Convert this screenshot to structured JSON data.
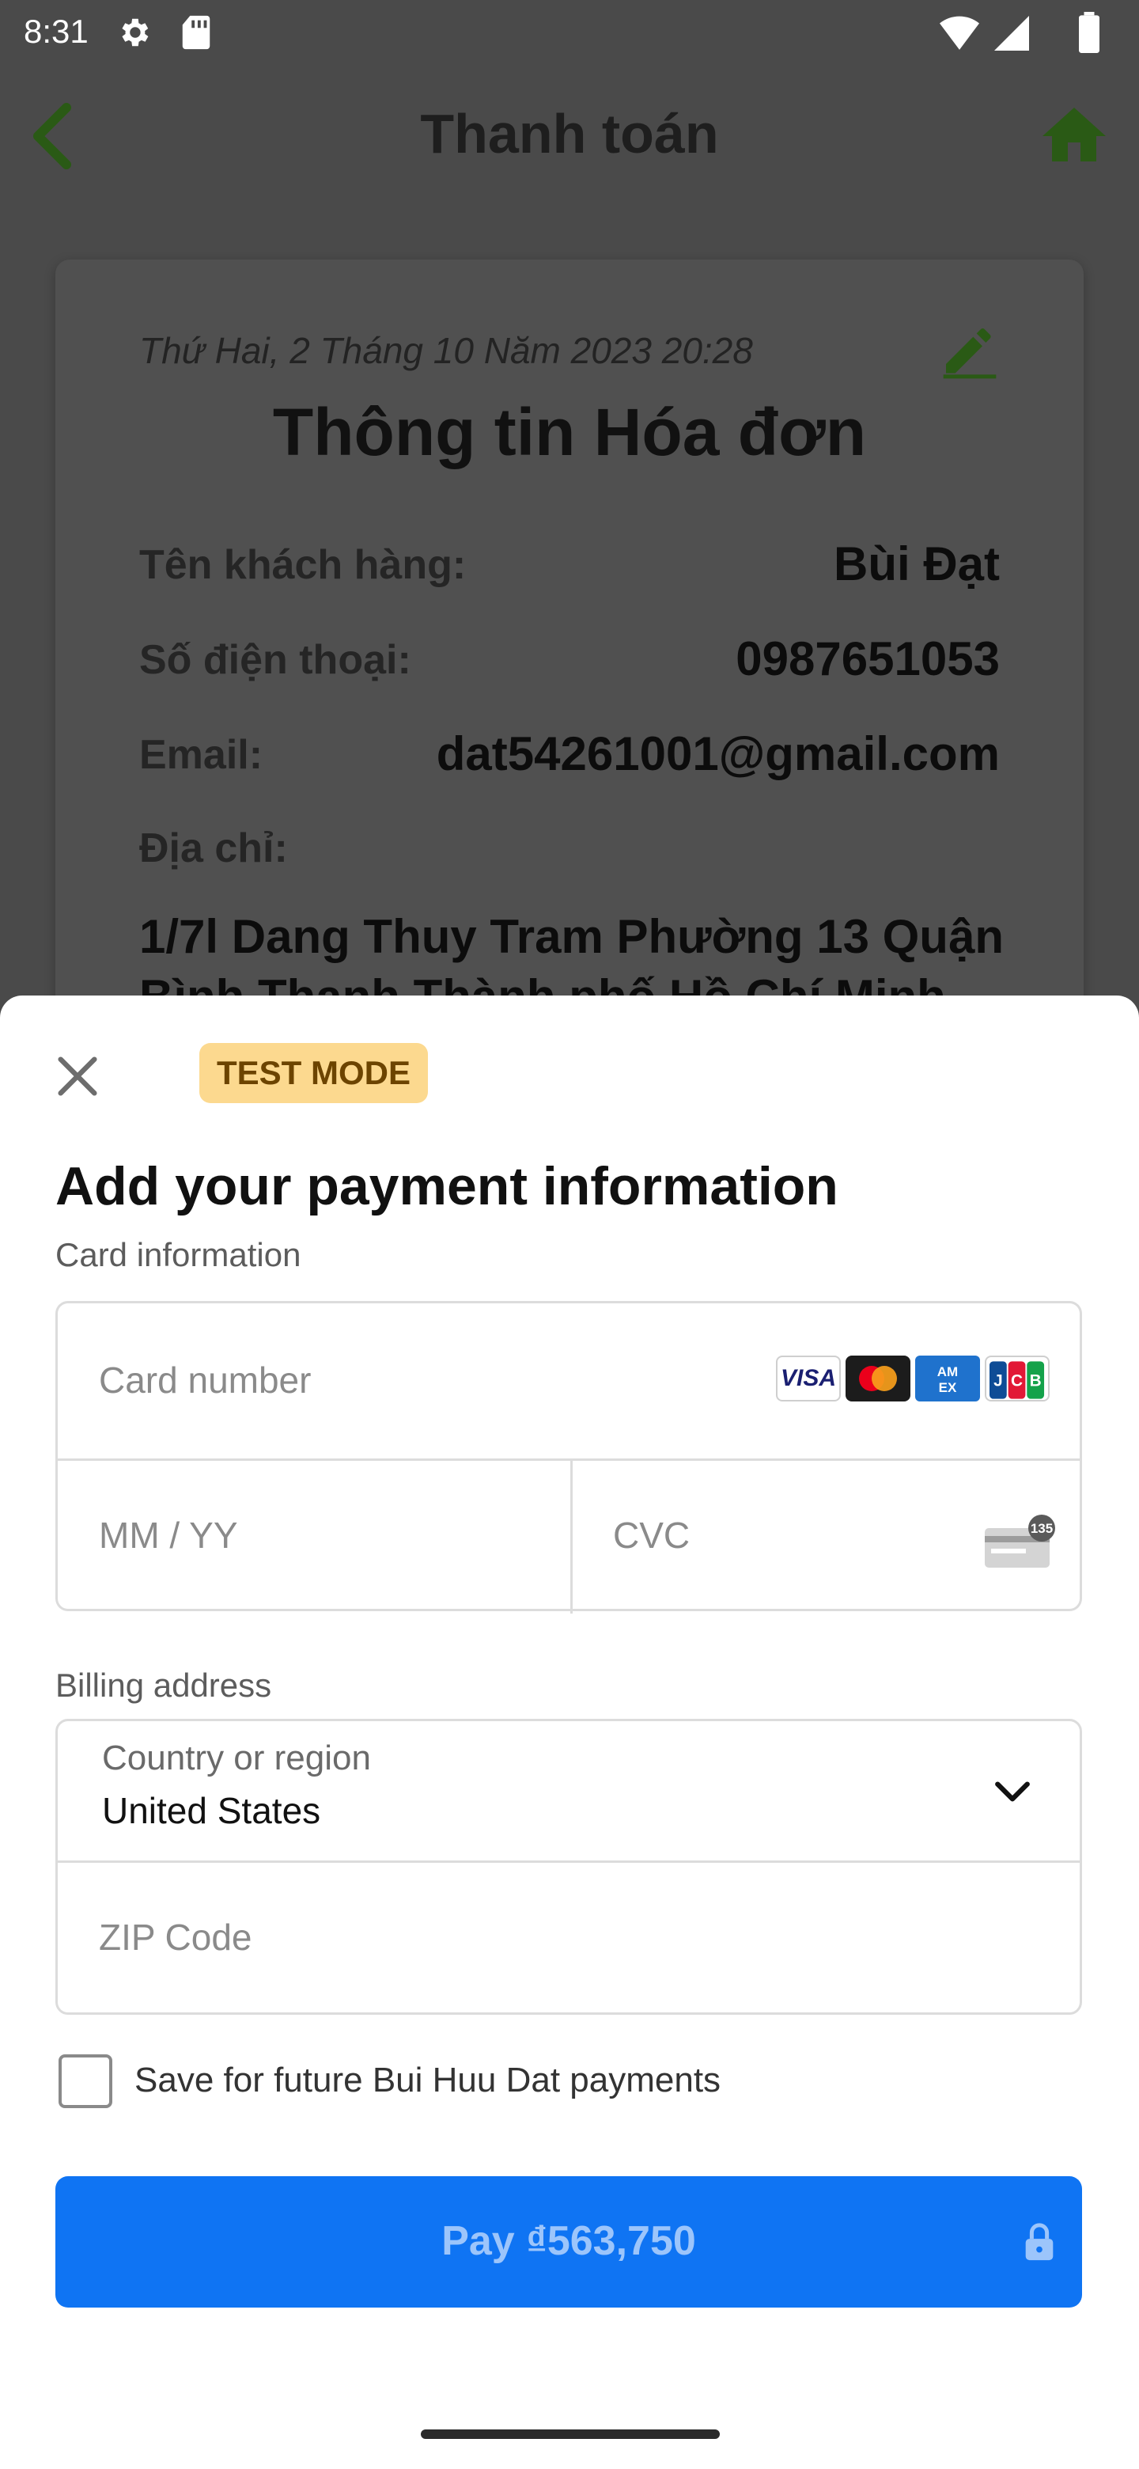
{
  "status_bar": {
    "time": "8:31"
  },
  "app_bar": {
    "title": "Thanh toán"
  },
  "invoice": {
    "date": "Thứ Hai, 2 Tháng 10 Năm 2023 20:28",
    "title": "Thông tin Hóa đơn",
    "customer_label": "Tên khách hàng:",
    "customer_value": "Bùi Đạt",
    "phone_label": "Số điện thoại:",
    "phone_value": "0987651053",
    "email_label": "Email:",
    "email_value": "dat54261001@gmail.com",
    "address_label": "Địa chỉ:",
    "address_value": "1/7l Dang Thuy Tram Phường 13 Quận Bình Thạnh Thành phố Hồ Chí Minh"
  },
  "sheet": {
    "badge": "TEST MODE",
    "title": "Add your payment information",
    "card_section_label": "Card information",
    "card_number_placeholder": "Card number",
    "card_brands": [
      "VISA",
      "Mastercard",
      "AMEX",
      "JCB"
    ],
    "expiry_placeholder": "MM / YY",
    "cvc_placeholder": "CVC",
    "cvc_hint": "135",
    "billing_section_label": "Billing address",
    "country_label": "Country or region",
    "country_value": "United States",
    "zip_placeholder": "ZIP Code",
    "save_label": "Save for future Bui Huu Dat payments",
    "save_checked": false,
    "pay_label": "Pay ₫563,750"
  },
  "colors": {
    "accent_green": "#2f6b1a",
    "pay_button": "#0f74f3",
    "badge_bg": "#fcd98f"
  }
}
